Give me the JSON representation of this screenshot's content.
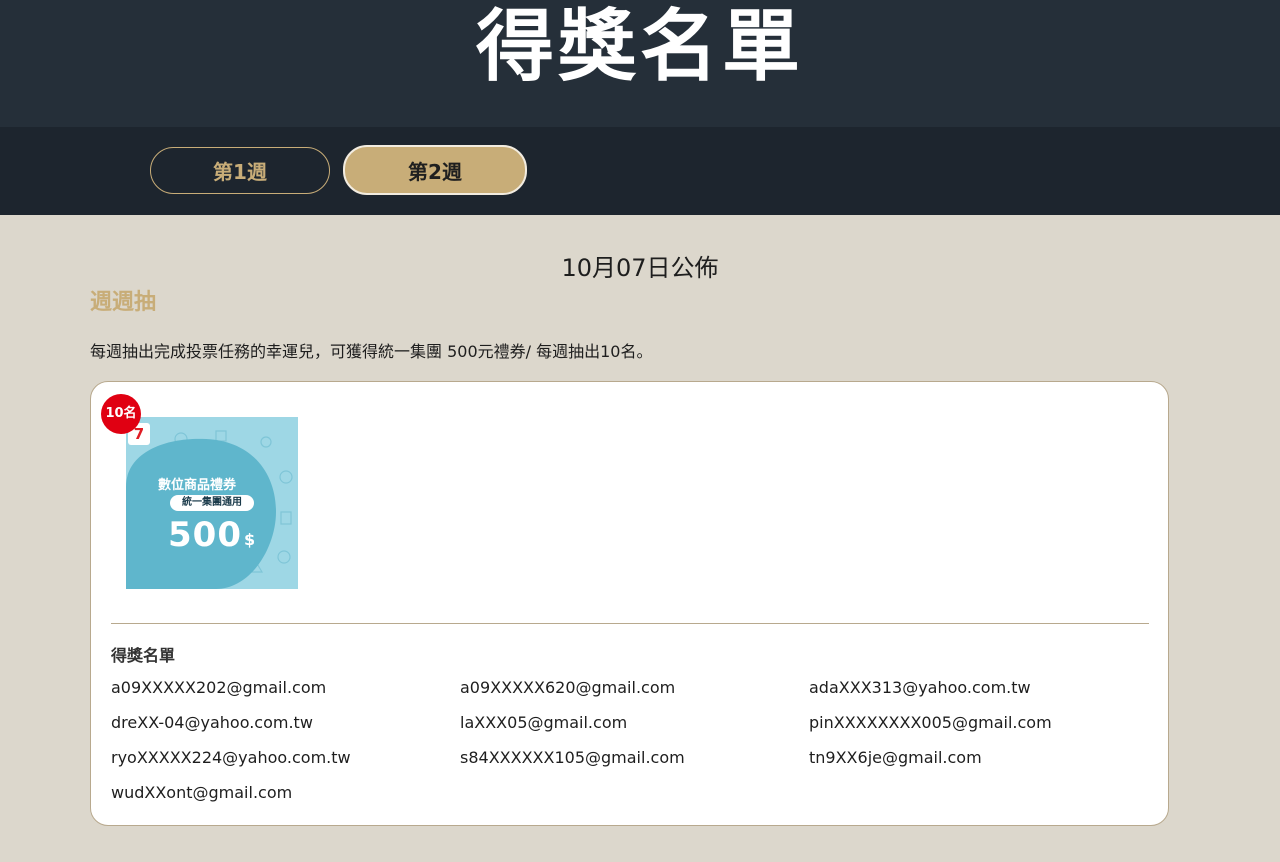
{
  "header": {
    "title": "得獎名單"
  },
  "tabs": [
    {
      "label": "第1週",
      "active": false
    },
    {
      "label": "第2週",
      "active": true
    }
  ],
  "publish_date": "10月07日公佈",
  "section": {
    "title": "週週抽",
    "description": "每週抽出完成投票任務的幸運兒，可獲得統一集團 500元禮券/ 每週抽出10名。"
  },
  "prize": {
    "badge": "10名",
    "label": "數位商品禮券",
    "chip": "統一集團通用",
    "amount": "500",
    "currency": "$",
    "logo": "7"
  },
  "winners": {
    "heading": "得獎名單",
    "list": [
      "a09XXXXX202@gmail.com",
      "a09XXXXX620@gmail.com",
      "adaXXX313@yahoo.com.tw",
      "dreXX-04@yahoo.com.tw",
      "laXXX05@gmail.com",
      "pinXXXXXXXX005@gmail.com",
      "ryoXXXXX224@yahoo.com.tw",
      "s84XXXXXX105@gmail.com",
      "tn9XX6je@gmail.com",
      "wudXXont@gmail.com"
    ]
  },
  "colors": {
    "header_bg": "#252f39",
    "tabbar_bg": "#1d252e",
    "accent_gold": "#c8ad78",
    "page_bg": "#dcd7cc",
    "badge_red": "#e00012",
    "prize_blue": "#93d3e2"
  }
}
